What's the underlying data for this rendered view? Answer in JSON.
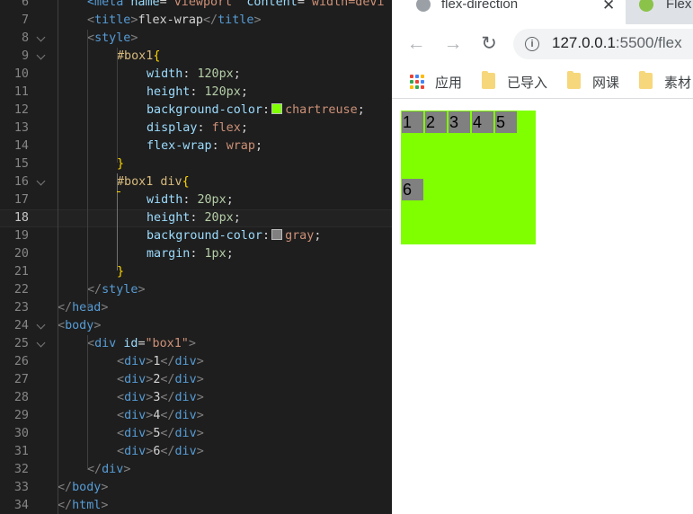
{
  "editor": {
    "lines": [
      {
        "n": "6",
        "tokens": [
          [
            "tag",
            "<meta"
          ],
          [
            "txt",
            " "
          ],
          [
            "attr",
            "name"
          ],
          [
            "txt",
            "="
          ],
          [
            "str",
            "\"viewport\""
          ],
          [
            "txt",
            " "
          ],
          [
            "attr",
            "content"
          ],
          [
            "txt",
            "="
          ],
          [
            "str",
            "\"width=devi"
          ]
        ]
      },
      {
        "n": "7",
        "tokens": [
          [
            "br",
            "<"
          ],
          [
            "tag",
            "title"
          ],
          [
            "br",
            ">"
          ],
          [
            "txt",
            "flex-wrap"
          ],
          [
            "br",
            "</"
          ],
          [
            "tag",
            "title"
          ],
          [
            "br",
            ">"
          ]
        ]
      },
      {
        "n": "8",
        "tokens": [
          [
            "br",
            "<"
          ],
          [
            "tag",
            "style"
          ],
          [
            "br",
            ">"
          ]
        ]
      },
      {
        "n": "9",
        "tokens": [
          [
            "sel",
            "#box1"
          ],
          [
            "brace",
            "{"
          ]
        ]
      },
      {
        "n": "10",
        "tokens": [
          [
            "prop",
            "width"
          ],
          [
            "txt",
            ": "
          ],
          [
            "num",
            "120px"
          ],
          [
            "txt",
            ";"
          ]
        ]
      },
      {
        "n": "11",
        "tokens": [
          [
            "prop",
            "height"
          ],
          [
            "txt",
            ": "
          ],
          [
            "num",
            "120px"
          ],
          [
            "txt",
            ";"
          ]
        ]
      },
      {
        "n": "12",
        "tokens": [
          [
            "prop",
            "background-color"
          ],
          [
            "txt",
            ":"
          ],
          [
            "swatch",
            "#7fff00"
          ],
          [
            "val",
            "chartreuse"
          ],
          [
            "txt",
            ";"
          ]
        ]
      },
      {
        "n": "13",
        "tokens": [
          [
            "prop",
            "display"
          ],
          [
            "txt",
            ": "
          ],
          [
            "val",
            "flex"
          ],
          [
            "txt",
            ";"
          ]
        ]
      },
      {
        "n": "14",
        "tokens": [
          [
            "prop",
            "flex-wrap"
          ],
          [
            "txt",
            ": "
          ],
          [
            "val",
            "wrap"
          ],
          [
            "txt",
            ";"
          ]
        ]
      },
      {
        "n": "15",
        "tokens": [
          [
            "brace",
            "}"
          ]
        ]
      },
      {
        "n": "16",
        "tokens": [
          [
            "sel",
            "#box1 div"
          ],
          [
            "brace",
            "{"
          ]
        ]
      },
      {
        "n": "17",
        "tokens": [
          [
            "prop",
            "width"
          ],
          [
            "txt",
            ": "
          ],
          [
            "num",
            "20px"
          ],
          [
            "txt",
            ";"
          ]
        ]
      },
      {
        "n": "18",
        "tokens": [
          [
            "prop",
            "height"
          ],
          [
            "txt",
            ": "
          ],
          [
            "num",
            "20px"
          ],
          [
            "txt",
            ";"
          ]
        ]
      },
      {
        "n": "19",
        "tokens": [
          [
            "prop",
            "background-color"
          ],
          [
            "txt",
            ":"
          ],
          [
            "swatch",
            "#808080"
          ],
          [
            "val",
            "gray"
          ],
          [
            "txt",
            ";"
          ]
        ]
      },
      {
        "n": "20",
        "tokens": [
          [
            "prop",
            "margin"
          ],
          [
            "txt",
            ": "
          ],
          [
            "num",
            "1px"
          ],
          [
            "txt",
            ";"
          ]
        ]
      },
      {
        "n": "21",
        "tokens": [
          [
            "brace",
            "}"
          ]
        ]
      },
      {
        "n": "22",
        "tokens": [
          [
            "br",
            "</"
          ],
          [
            "tag",
            "style"
          ],
          [
            "br",
            ">"
          ]
        ]
      },
      {
        "n": "23",
        "tokens": [
          [
            "br",
            "</"
          ],
          [
            "tag",
            "head"
          ],
          [
            "br",
            ">"
          ]
        ]
      },
      {
        "n": "24",
        "tokens": [
          [
            "br",
            "<"
          ],
          [
            "tag",
            "body"
          ],
          [
            "br",
            ">"
          ]
        ]
      },
      {
        "n": "25",
        "tokens": [
          [
            "br",
            "<"
          ],
          [
            "tag",
            "div"
          ],
          [
            "txt",
            " "
          ],
          [
            "attr",
            "id"
          ],
          [
            "txt",
            "="
          ],
          [
            "str",
            "\"box1\""
          ],
          [
            "br",
            ">"
          ]
        ]
      },
      {
        "n": "26",
        "tokens": [
          [
            "br",
            "<"
          ],
          [
            "tag",
            "div"
          ],
          [
            "br",
            ">"
          ],
          [
            "txt",
            "1"
          ],
          [
            "br",
            "</"
          ],
          [
            "tag",
            "div"
          ],
          [
            "br",
            ">"
          ]
        ]
      },
      {
        "n": "27",
        "tokens": [
          [
            "br",
            "<"
          ],
          [
            "tag",
            "div"
          ],
          [
            "br",
            ">"
          ],
          [
            "txt",
            "2"
          ],
          [
            "br",
            "</"
          ],
          [
            "tag",
            "div"
          ],
          [
            "br",
            ">"
          ]
        ]
      },
      {
        "n": "28",
        "tokens": [
          [
            "br",
            "<"
          ],
          [
            "tag",
            "div"
          ],
          [
            "br",
            ">"
          ],
          [
            "txt",
            "3"
          ],
          [
            "br",
            "</"
          ],
          [
            "tag",
            "div"
          ],
          [
            "br",
            ">"
          ]
        ]
      },
      {
        "n": "29",
        "tokens": [
          [
            "br",
            "<"
          ],
          [
            "tag",
            "div"
          ],
          [
            "br",
            ">"
          ],
          [
            "txt",
            "4"
          ],
          [
            "br",
            "</"
          ],
          [
            "tag",
            "div"
          ],
          [
            "br",
            ">"
          ]
        ]
      },
      {
        "n": "30",
        "tokens": [
          [
            "br",
            "<"
          ],
          [
            "tag",
            "div"
          ],
          [
            "br",
            ">"
          ],
          [
            "txt",
            "5"
          ],
          [
            "br",
            "</"
          ],
          [
            "tag",
            "div"
          ],
          [
            "br",
            ">"
          ]
        ]
      },
      {
        "n": "31",
        "tokens": [
          [
            "br",
            "<"
          ],
          [
            "tag",
            "div"
          ],
          [
            "br",
            ">"
          ],
          [
            "txt",
            "6"
          ],
          [
            "br",
            "</"
          ],
          [
            "tag",
            "div"
          ],
          [
            "br",
            ">"
          ]
        ]
      },
      {
        "n": "32",
        "tokens": [
          [
            "br",
            "</"
          ],
          [
            "tag",
            "div"
          ],
          [
            "br",
            ">"
          ]
        ]
      },
      {
        "n": "33",
        "tokens": [
          [
            "br",
            "</"
          ],
          [
            "tag",
            "body"
          ],
          [
            "br",
            ">"
          ]
        ]
      },
      {
        "n": "34",
        "tokens": [
          [
            "br",
            "</"
          ],
          [
            "tag",
            "html"
          ],
          [
            "br",
            ">"
          ]
        ]
      }
    ],
    "current_line": "18"
  },
  "browser": {
    "tabs": [
      {
        "title": "flex-direction",
        "icon": "globe-icon",
        "active": true
      },
      {
        "title": "Flex",
        "icon": "vscode-live-server-icon",
        "active": false
      }
    ],
    "url_host": "127.0.0.1",
    "url_rest": ":5500/flex",
    "bookmarks": [
      {
        "label": "应用",
        "icon": "apps-grid-icon"
      },
      {
        "label": "已导入",
        "icon": "folder-icon"
      },
      {
        "label": "网课",
        "icon": "folder-icon"
      },
      {
        "label": "素材",
        "icon": "folder-icon"
      }
    ],
    "flex_items": [
      "1",
      "2",
      "3",
      "4",
      "5",
      "6"
    ],
    "colors": {
      "box": "#7fff00",
      "item": "#808080"
    }
  }
}
